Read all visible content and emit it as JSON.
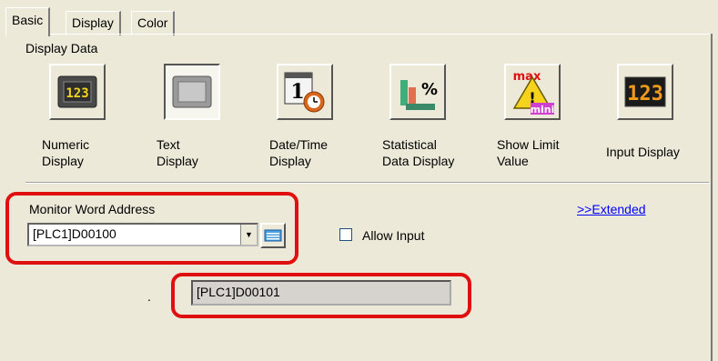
{
  "tabs": [
    {
      "label": "Basic",
      "active": true
    },
    {
      "label": "Display",
      "active": false
    },
    {
      "label": "Color",
      "active": false
    }
  ],
  "display_data": {
    "label": "Display Data",
    "items": [
      {
        "label": "Numeric\nDisplay",
        "icon": "numeric-display-icon",
        "selected": false
      },
      {
        "label": "Text\nDisplay",
        "icon": "text-display-icon",
        "selected": true
      },
      {
        "label": "Date/Time\nDisplay",
        "icon": "datetime-display-icon",
        "selected": false
      },
      {
        "label": "Statistical\nData Display",
        "icon": "statistical-display-icon",
        "selected": false
      },
      {
        "label": "Show Limit\nValue",
        "icon": "limit-value-icon",
        "selected": false
      },
      {
        "label": "Input Display",
        "icon": "input-display-icon",
        "selected": false
      }
    ]
  },
  "monitor": {
    "label": "Monitor Word Address",
    "value": "[PLC1]D00100",
    "allow_input_label": "Allow Input",
    "allow_input_checked": false,
    "extended_link": ">>Extended"
  },
  "secondary": {
    "prefix": ".",
    "value": "[PLC1]D00101"
  },
  "colors": {
    "highlight": "#e01010",
    "link": "#0000ff",
    "panel": "#ece9d8"
  }
}
